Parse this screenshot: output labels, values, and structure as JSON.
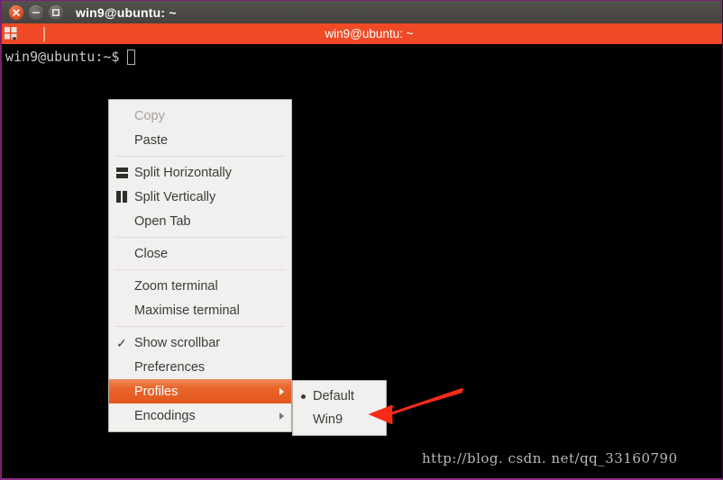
{
  "window": {
    "title": "win9@ubuntu: ~",
    "controls": [
      {
        "name": "close",
        "glyph": "x"
      },
      {
        "name": "minimize",
        "glyph": "-"
      },
      {
        "name": "maximize",
        "glyph": "[]"
      }
    ]
  },
  "tabbar": {
    "layout_icon": "layout-grid-icon",
    "tab_title": "win9@ubuntu: ~",
    "accent_color": "#ef4a25"
  },
  "terminal": {
    "prompt": "win9@ubuntu:~$",
    "cursor": "block-cursor",
    "background": "#000000",
    "foreground": "#c9c9c9"
  },
  "context_menu": {
    "highlight_color": "#e2571d",
    "background": "#f2f0ef",
    "items": [
      {
        "label": "Copy",
        "state": "disabled"
      },
      {
        "label": "Paste",
        "state": "enabled"
      },
      {
        "label": "Split Horizontally",
        "state": "enabled",
        "icon": "split-horizontal-icon"
      },
      {
        "label": "Split Vertically",
        "state": "enabled",
        "icon": "split-vertical-icon"
      },
      {
        "label": "Open Tab",
        "state": "enabled"
      },
      {
        "label": "Close",
        "state": "enabled"
      },
      {
        "label": "Zoom terminal",
        "state": "enabled"
      },
      {
        "label": "Maximise terminal",
        "state": "enabled"
      },
      {
        "label": "Show scrollbar",
        "state": "checked",
        "icon": "check-icon"
      },
      {
        "label": "Preferences",
        "state": "enabled"
      },
      {
        "label": "Profiles",
        "state": "selected",
        "icon": "submenu-arrow-icon"
      },
      {
        "label": "Encodings",
        "state": "enabled",
        "icon": "submenu-arrow-icon"
      }
    ]
  },
  "profiles_submenu": {
    "items": [
      {
        "label": "Default",
        "state": "selected-radio"
      },
      {
        "label": "Win9",
        "state": "enabled"
      }
    ]
  },
  "annotation": {
    "arrow_color": "#f92b18",
    "points_to": "Win9"
  },
  "watermark": {
    "text": "http://blog. csdn. net/qq_33160790"
  }
}
